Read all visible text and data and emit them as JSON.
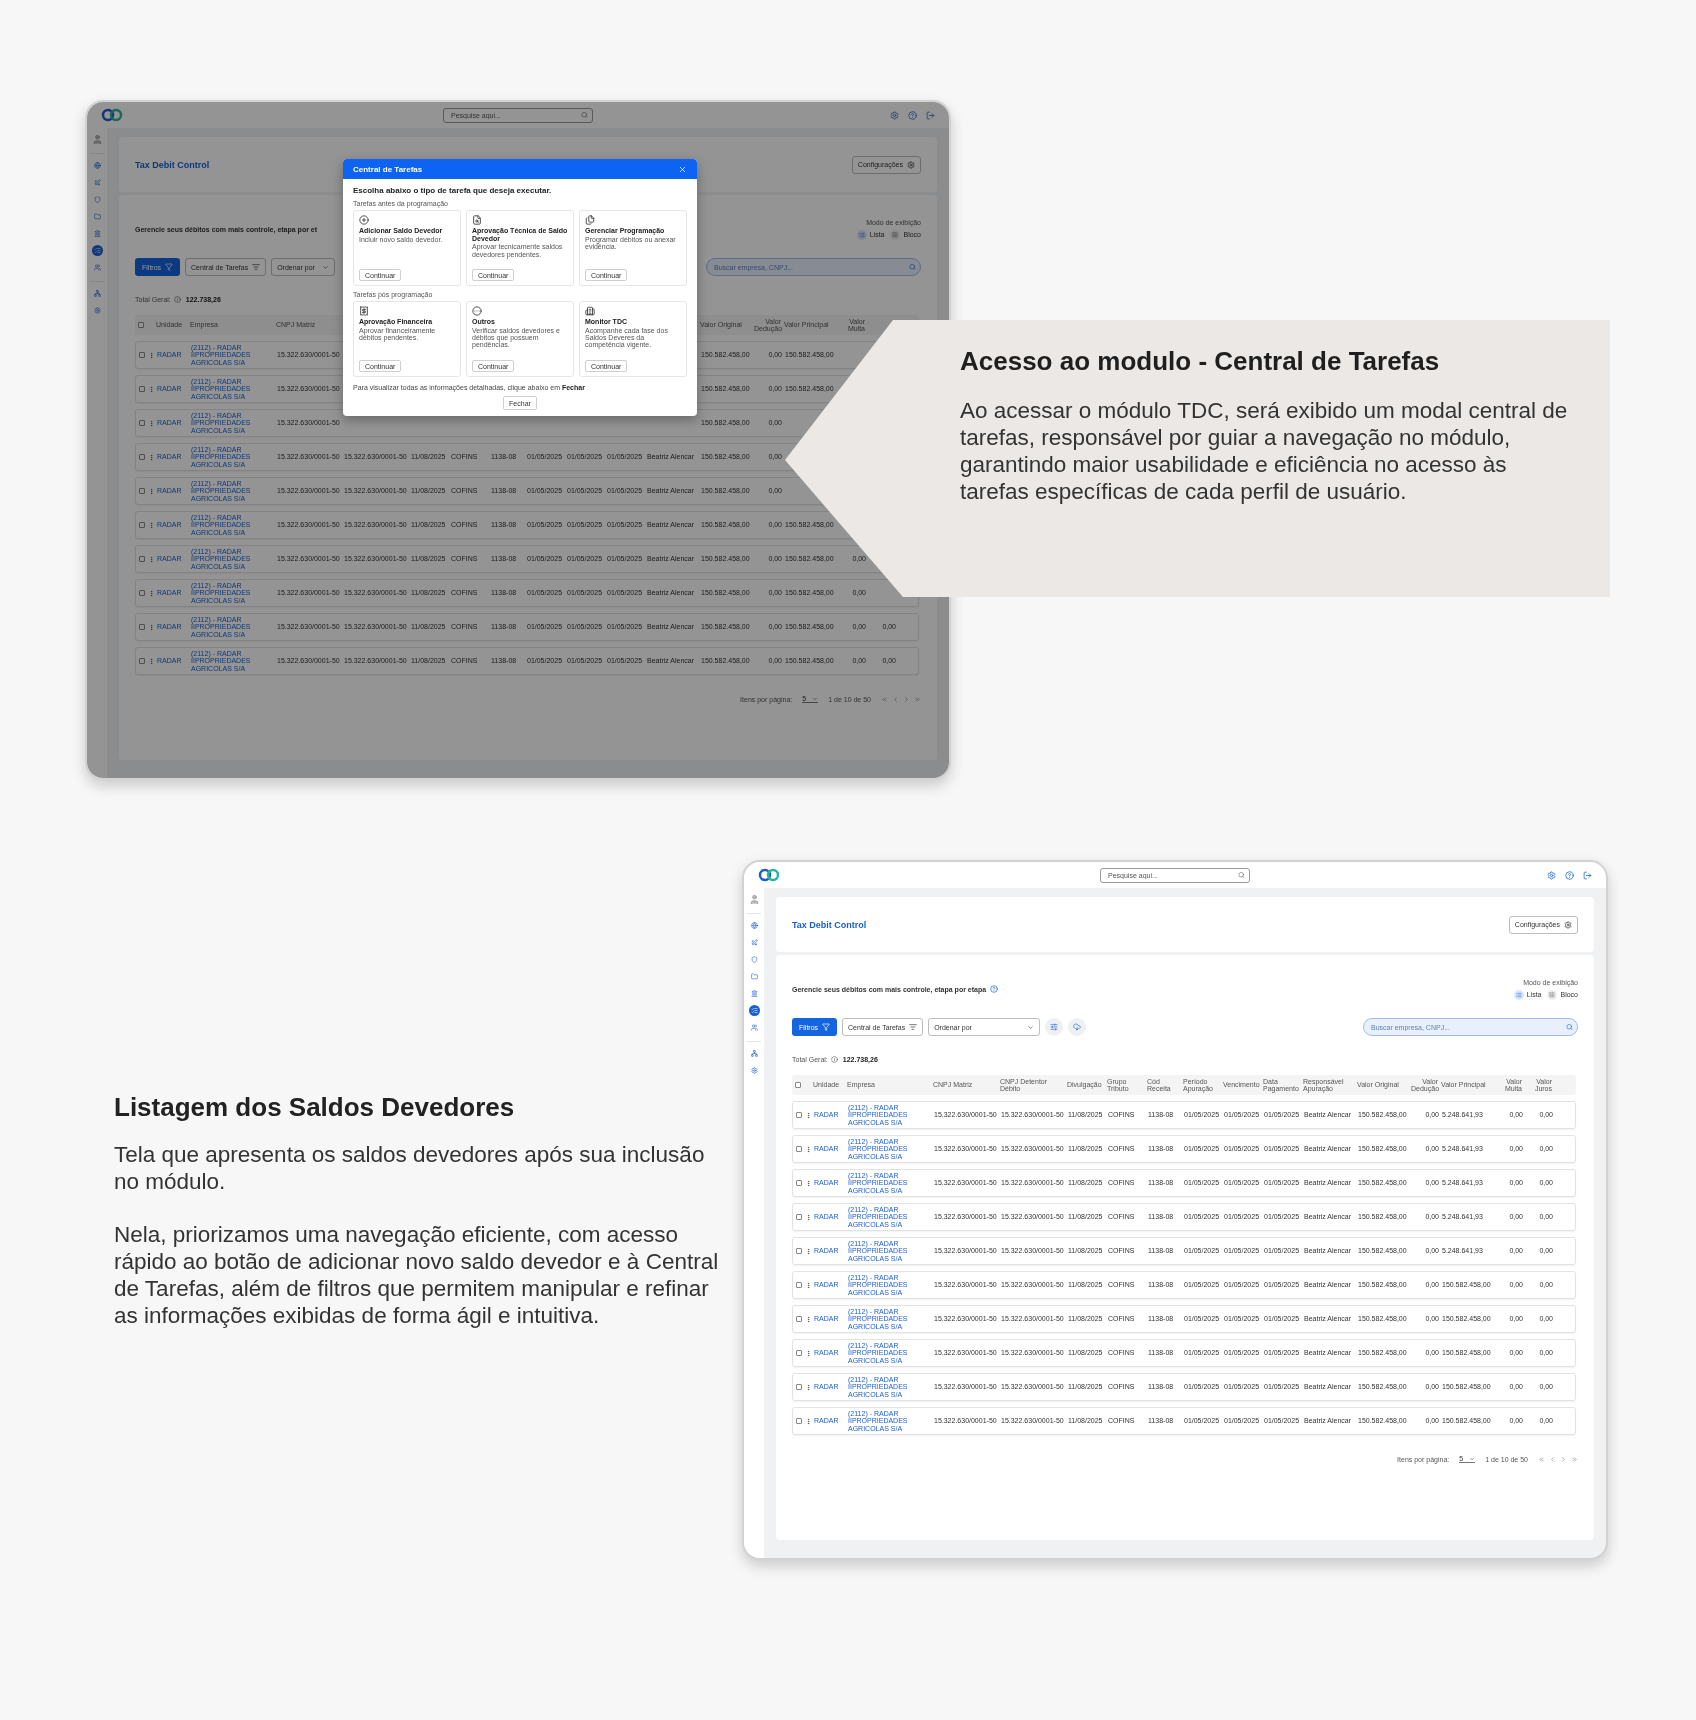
{
  "top_screen": {
    "topbar": {
      "search_placeholder": "Pesquise aqui..."
    },
    "sidebar": {
      "groups": [
        {
          "items": [
            {
              "selected": false
            },
            {
              "selected": false
            },
            {
              "selected": false
            },
            {
              "selected": false
            },
            {
              "selected": false
            },
            {
              "selected": true
            },
            {
              "selected": false
            }
          ]
        },
        {
          "items": [
            {
              "selected": false
            },
            {
              "selected": false
            }
          ]
        }
      ]
    },
    "header": {
      "title": "Tax Debit Control",
      "settings_button": "Configurações"
    },
    "content": {
      "title": "Gerencie seus débitos com mais controle, etapa por et",
      "help_icon": false,
      "view_mode": {
        "label": "Modo de exibição",
        "options": [
          {
            "label": "Lista",
            "selected": true
          },
          {
            "label": "Bloco",
            "selected": false
          }
        ]
      },
      "toolbar": {
        "filter_button": "Filtros",
        "tasks_button": "Central de Tarefas",
        "sort": "Ordenar por",
        "extra_tools": false,
        "search_placeholder": "Buscar empresa, CNPJ..."
      },
      "total": {
        "label": "Total Geral:",
        "value": "122.738,26"
      },
      "table": {
        "all_checked": false,
        "header": {
          "unit": "Unidade",
          "company": "Empresa",
          "cnpj": "CNPJ Matriz",
          "original": "Valor Original",
          "deduction": "Valor Dedução",
          "principal": "Valor Principal",
          "fine": "Valor Multa"
        },
        "rows": [
          {
            "checked": false,
            "unit": "RADAR",
            "company": "(2112) - RADAR IIPROPRIEDADES AGRICOLAS S/A",
            "cnpj": "15.322.630/0001-50",
            "original": "150.582.458,00",
            "deduction": "0,00",
            "principal": "150.582.458,00"
          },
          {
            "checked": false,
            "unit": "RADAR",
            "company": "(2112) - RADAR IIPROPRIEDADES AGRICOLAS S/A",
            "cnpj": "15.322.630/0001-50",
            "original": "150.582.458,00",
            "deduction": "0,00",
            "principal": "150.582.458,00"
          },
          {
            "checked": false,
            "unit": "RADAR",
            "company": "(2112) - RADAR IIPROPRIEDADES AGRICOLAS S/A",
            "cnpj": "15.322.630/0001-50",
            "original": "150.582.458,00",
            "deduction": "0,00"
          },
          {
            "checked": false,
            "unit": "RADAR",
            "company": "(2112) - RADAR IIPROPRIEDADES AGRICOLAS S/A",
            "cnpj": "15.322.630/0001-50",
            "holder": "15.322.630/0001-50",
            "disclosure": "11/08/2025",
            "group": "COFINS",
            "code": "1138-08",
            "period": "01/05/2025",
            "due": "01/05/2025",
            "paid": "01/05/2025",
            "owner": "Beatriz Alencar",
            "original": "150.582.458,00",
            "deduction": "0,00"
          },
          {
            "checked": false,
            "unit": "RADAR",
            "company": "(2112) - RADAR IIPROPRIEDADES AGRICOLAS S/A",
            "cnpj": "15.322.630/0001-50",
            "holder": "15.322.630/0001-50",
            "disclosure": "11/08/2025",
            "group": "COFINS",
            "code": "1138-08",
            "period": "01/05/2025",
            "due": "01/05/2025",
            "paid": "01/05/2025",
            "owner": "Beatriz Alencar",
            "original": "150.582.458,00",
            "deduction": "0,00"
          },
          {
            "checked": false,
            "unit": "RADAR",
            "company": "(2112) - RADAR IIPROPRIEDADES AGRICOLAS S/A",
            "cnpj": "15.322.630/0001-50",
            "holder": "15.322.630/0001-50",
            "disclosure": "11/08/2025",
            "group": "COFINS",
            "code": "1138-08",
            "period": "01/05/2025",
            "due": "01/05/2025",
            "paid": "01/05/2025",
            "owner": "Beatriz Alencar",
            "original": "150.582.458,00",
            "deduction": "0,00",
            "principal": "150.582.458,00"
          },
          {
            "checked": false,
            "unit": "RADAR",
            "company": "(2112) - RADAR IIPROPRIEDADES AGRICOLAS S/A",
            "cnpj": "15.322.630/0001-50",
            "holder": "15.322.630/0001-50",
            "disclosure": "11/08/2025",
            "group": "COFINS",
            "code": "1138-08",
            "period": "01/05/2025",
            "due": "01/05/2025",
            "paid": "01/05/2025",
            "owner": "Beatriz Alencar",
            "original": "150.582.458,00",
            "deduction": "0,00",
            "principal": "150.582.458,00",
            "fine": "0,00"
          },
          {
            "checked": false,
            "unit": "RADAR",
            "company": "(2112) - RADAR IIPROPRIEDADES AGRICOLAS S/A",
            "cnpj": "15.322.630/0001-50",
            "holder": "15.322.630/0001-50",
            "disclosure": "11/08/2025",
            "group": "COFINS",
            "code": "1138-08",
            "period": "01/05/2025",
            "due": "01/05/2025",
            "paid": "01/05/2025",
            "owner": "Beatriz Alencar",
            "original": "150.582.458,00",
            "deduction": "0,00",
            "principal": "150.582.458,00",
            "fine": "0,00"
          },
          {
            "checked": false,
            "unit": "RADAR",
            "company": "(2112) - RADAR IIPROPRIEDADES AGRICOLAS S/A",
            "cnpj": "15.322.630/0001-50",
            "holder": "15.322.630/0001-50",
            "disclosure": "11/08/2025",
            "group": "COFINS",
            "code": "1138-08",
            "period": "01/05/2025",
            "due": "01/05/2025",
            "paid": "01/05/2025",
            "owner": "Beatriz Alencar",
            "original": "150.582.458,00",
            "deduction": "0,00",
            "principal": "150.582.458,00",
            "fine": "0,00",
            "interest": "0,00"
          },
          {
            "checked": false,
            "unit": "RADAR",
            "company": "(2112) - RADAR IIPROPRIEDADES AGRICOLAS S/A",
            "cnpj": "15.322.630/0001-50",
            "holder": "15.322.630/0001-50",
            "disclosure": "11/08/2025",
            "group": "COFINS",
            "code": "1138-08",
            "period": "01/05/2025",
            "due": "01/05/2025",
            "paid": "01/05/2025",
            "owner": "Beatriz Alencar",
            "original": "150.582.458,00",
            "deduction": "0,00",
            "principal": "150.582.458,00",
            "fine": "0,00",
            "interest": "0,00"
          }
        ]
      },
      "pagination": {
        "label": "Itens por página:",
        "per_page": "5",
        "range": "1 de 10 de 50"
      }
    },
    "modal": {
      "title": "Central de Tarefas",
      "prompt": "Escolha abaixo o tipo de tarefa que deseja executar.",
      "groups": [
        {
          "title": "Tarefas antes da programação",
          "tasks": [
            {
              "kind": "add",
              "title": "Adicionar Saldo Devedor",
              "description": "Incluir novo saldo devedor.",
              "button": "Continuar"
            },
            {
              "kind": "approval",
              "title": "Aprovação Técnica de Saldo Devedor",
              "description": "Aprovar tecnicamente saldos devedores pendentes.",
              "button": "Continuar"
            },
            {
              "kind": "schedule",
              "title": "Gerenciar Programação",
              "description": "Programar débitos ou anexar evidência.",
              "button": "Continuar"
            }
          ]
        },
        {
          "title": "Tarefas pós programação",
          "tasks": [
            {
              "kind": "finance",
              "title": "Aprovação Financeira",
              "description": "Aprovar financeiramente débitos pendentes.",
              "button": "Continuar"
            },
            {
              "kind": "other",
              "title": "Outros",
              "description": "Verificar saldos devedores e débitos que possuem pendências.",
              "button": "Continuar"
            },
            {
              "kind": "monitor",
              "title": "Monitor TDC",
              "description": "Acompanhe cada fase dos Saldos Deveres da competência vigente.",
              "button": "Continuar"
            }
          ]
        }
      ],
      "footer": "Para visualizar todas as informações detalhadas, clique abaixo em **Fechar**",
      "close_button": "Fechar"
    }
  },
  "callout": {
    "title": "Acesso ao modulo - Central de Tarefas",
    "text": "Ao acessar o módulo TDC, será exibido um modal central de tarefas, responsável por guiar a navegação no módulo, garantindo maior usabilidade e eficiência no acesso às tarefas específicas de cada perfil de usuário."
  },
  "section": {
    "title": "Listagem dos Saldos Devedores",
    "paragraphs": [
      "Tela que apresenta os saldos devedores após sua inclusão no módulo.",
      "Nela, priorizamos uma navegação eficiente, com acesso rápido ao botão de adicionar novo saldo devedor e à Central de Tarefas, além de filtros que permitem manipular e refinar as informações exibidas de forma ágil e intuitiva."
    ]
  },
  "bottom_screen": {
    "topbar": {
      "search_placeholder": "Pesquise aqui..."
    },
    "sidebar": {
      "groups": [
        {
          "items": [
            {
              "selected": false
            },
            {
              "selected": false
            },
            {
              "selected": false
            },
            {
              "selected": false
            },
            {
              "selected": false
            },
            {
              "selected": true
            },
            {
              "selected": false
            }
          ]
        },
        {
          "items": [
            {
              "selected": false
            },
            {
              "selected": false
            }
          ]
        }
      ]
    },
    "header": {
      "title": "Tax Debit Control",
      "settings_button": "Configurações"
    },
    "content": {
      "title": "Gerencie seus débitos com mais controle, etapa por etapa",
      "help_icon": true,
      "view_mode": {
        "label": "Modo de exibição",
        "options": [
          {
            "label": "Lista",
            "selected": true
          },
          {
            "label": "Bloco",
            "selected": false
          }
        ]
      },
      "toolbar": {
        "filter_button": "Filtros",
        "tasks_button": "Central de Tarefas",
        "sort": "Ordenar por",
        "extra_tools": true,
        "search_placeholder": "Buscar empresa, CNPJ..."
      },
      "total": {
        "label": "Total Geral:",
        "value": "122.738,26"
      },
      "table": {
        "all_checked": false,
        "header": {
          "unit": "Unidade",
          "company": "Empresa",
          "cnpj": "CNPJ Matriz",
          "holder": "CNPJ Detentor Débito",
          "disclosure": "Divulgação",
          "group": "Grupo Tributo",
          "code": "Cód Receita",
          "period": "Período Apuração",
          "due": "Vencimento",
          "paid": "Data Pagamento",
          "owner": "Responsável Apuração",
          "original": "Valor Original",
          "deduction": "Valor Dedução",
          "principal": "Valor Principal",
          "fine": "Valor Multa",
          "interest": "Valor Juros"
        },
        "rows": [
          {
            "checked": false,
            "unit": "RADAR",
            "company": "(2112) - RADAR IIPROPRIEDADES AGRICOLAS S/A",
            "cnpj": "15.322.630/0001-50",
            "holder": "15.322.630/0001-50",
            "disclosure": "11/08/2025",
            "group": "COFINS",
            "code": "1138-08",
            "period": "01/05/2025",
            "due": "01/05/2025",
            "paid": "01/05/2025",
            "owner": "Beatriz Alencar",
            "original": "150.582.458,00",
            "deduction": "0,00",
            "principal": "5.248.641,93",
            "fine": "0,00",
            "interest": "0,00"
          },
          {
            "checked": false,
            "unit": "RADAR",
            "company": "(2112) - RADAR IIPROPRIEDADES AGRICOLAS S/A",
            "cnpj": "15.322.630/0001-50",
            "holder": "15.322.630/0001-50",
            "disclosure": "11/08/2025",
            "group": "COFINS",
            "code": "1138-08",
            "period": "01/05/2025",
            "due": "01/05/2025",
            "paid": "01/05/2025",
            "owner": "Beatriz Alencar",
            "original": "150.582.458,00",
            "deduction": "0,00",
            "principal": "5.248.641,93",
            "fine": "0,00",
            "interest": "0,00"
          },
          {
            "checked": false,
            "unit": "RADAR",
            "company": "(2112) - RADAR IIPROPRIEDADES AGRICOLAS S/A",
            "cnpj": "15.322.630/0001-50",
            "holder": "15.322.630/0001-50",
            "disclosure": "11/08/2025",
            "group": "COFINS",
            "code": "1138-08",
            "period": "01/05/2025",
            "due": "01/05/2025",
            "paid": "01/05/2025",
            "owner": "Beatriz Alencar",
            "original": "150.582.458,00",
            "deduction": "0,00",
            "principal": "5.248.641,93",
            "fine": "0,00",
            "interest": "0,00"
          },
          {
            "checked": false,
            "unit": "RADAR",
            "company": "(2112) - RADAR IIPROPRIEDADES AGRICOLAS S/A",
            "cnpj": "15.322.630/0001-50",
            "holder": "15.322.630/0001-50",
            "disclosure": "11/08/2025",
            "group": "COFINS",
            "code": "1138-08",
            "period": "01/05/2025",
            "due": "01/05/2025",
            "paid": "01/05/2025",
            "owner": "Beatriz Alencar",
            "original": "150.582.458,00",
            "deduction": "0,00",
            "principal": "5.248.641,93",
            "fine": "0,00",
            "interest": "0,00"
          },
          {
            "checked": false,
            "unit": "RADAR",
            "company": "(2112) - RADAR IIPROPRIEDADES AGRICOLAS S/A",
            "cnpj": "15.322.630/0001-50",
            "holder": "15.322.630/0001-50",
            "disclosure": "11/08/2025",
            "group": "COFINS",
            "code": "1138-08",
            "period": "01/05/2025",
            "due": "01/05/2025",
            "paid": "01/05/2025",
            "owner": "Beatriz Alencar",
            "original": "150.582.458,00",
            "deduction": "0,00",
            "principal": "5.248.641,93",
            "fine": "0,00",
            "interest": "0,00"
          },
          {
            "checked": false,
            "unit": "RADAR",
            "company": "(2112) - RADAR IIPROPRIEDADES AGRICOLAS S/A",
            "cnpj": "15.322.630/0001-50",
            "holder": "15.322.630/0001-50",
            "disclosure": "11/08/2025",
            "group": "COFINS",
            "code": "1138-08",
            "period": "01/05/2025",
            "due": "01/05/2025",
            "paid": "01/05/2025",
            "owner": "Beatriz Alencar",
            "original": "150.582.458,00",
            "deduction": "0,00",
            "principal": "150.582.458,00",
            "fine": "0,00",
            "interest": "0,00"
          },
          {
            "checked": false,
            "unit": "RADAR",
            "company": "(2112) - RADAR IIPROPRIEDADES AGRICOLAS S/A",
            "cnpj": "15.322.630/0001-50",
            "holder": "15.322.630/0001-50",
            "disclosure": "11/08/2025",
            "group": "COFINS",
            "code": "1138-08",
            "period": "01/05/2025",
            "due": "01/05/2025",
            "paid": "01/05/2025",
            "owner": "Beatriz Alencar",
            "original": "150.582.458,00",
            "deduction": "0,00",
            "principal": "150.582.458,00",
            "fine": "0,00",
            "interest": "0,00"
          },
          {
            "checked": false,
            "unit": "RADAR",
            "company": "(2112) - RADAR IIPROPRIEDADES AGRICOLAS S/A",
            "cnpj": "15.322.630/0001-50",
            "holder": "15.322.630/0001-50",
            "disclosure": "11/08/2025",
            "group": "COFINS",
            "code": "1138-08",
            "period": "01/05/2025",
            "due": "01/05/2025",
            "paid": "01/05/2025",
            "owner": "Beatriz Alencar",
            "original": "150.582.458,00",
            "deduction": "0,00",
            "principal": "150.582.458,00",
            "fine": "0,00",
            "interest": "0,00"
          },
          {
            "checked": false,
            "unit": "RADAR",
            "company": "(2112) - RADAR IIPROPRIEDADES AGRICOLAS S/A",
            "cnpj": "15.322.630/0001-50",
            "holder": "15.322.630/0001-50",
            "disclosure": "11/08/2025",
            "group": "COFINS",
            "code": "1138-08",
            "period": "01/05/2025",
            "due": "01/05/2025",
            "paid": "01/05/2025",
            "owner": "Beatriz Alencar",
            "original": "150.582.458,00",
            "deduction": "0,00",
            "principal": "150.582.458,00",
            "fine": "0,00",
            "interest": "0,00"
          },
          {
            "checked": false,
            "unit": "RADAR",
            "company": "(2112) - RADAR IIPROPRIEDADES AGRICOLAS S/A",
            "cnpj": "15.322.630/0001-50",
            "holder": "15.322.630/0001-50",
            "disclosure": "11/08/2025",
            "group": "COFINS",
            "code": "1138-08",
            "period": "01/05/2025",
            "due": "01/05/2025",
            "paid": "01/05/2025",
            "owner": "Beatriz Alencar",
            "original": "150.582.458,00",
            "deduction": "0,00",
            "principal": "150.582.458,00",
            "fine": "0,00",
            "interest": "0,00"
          }
        ]
      },
      "pagination": {
        "label": "Itens por página:",
        "per_page": "5",
        "range": "1 de 10 de 50"
      }
    }
  }
}
